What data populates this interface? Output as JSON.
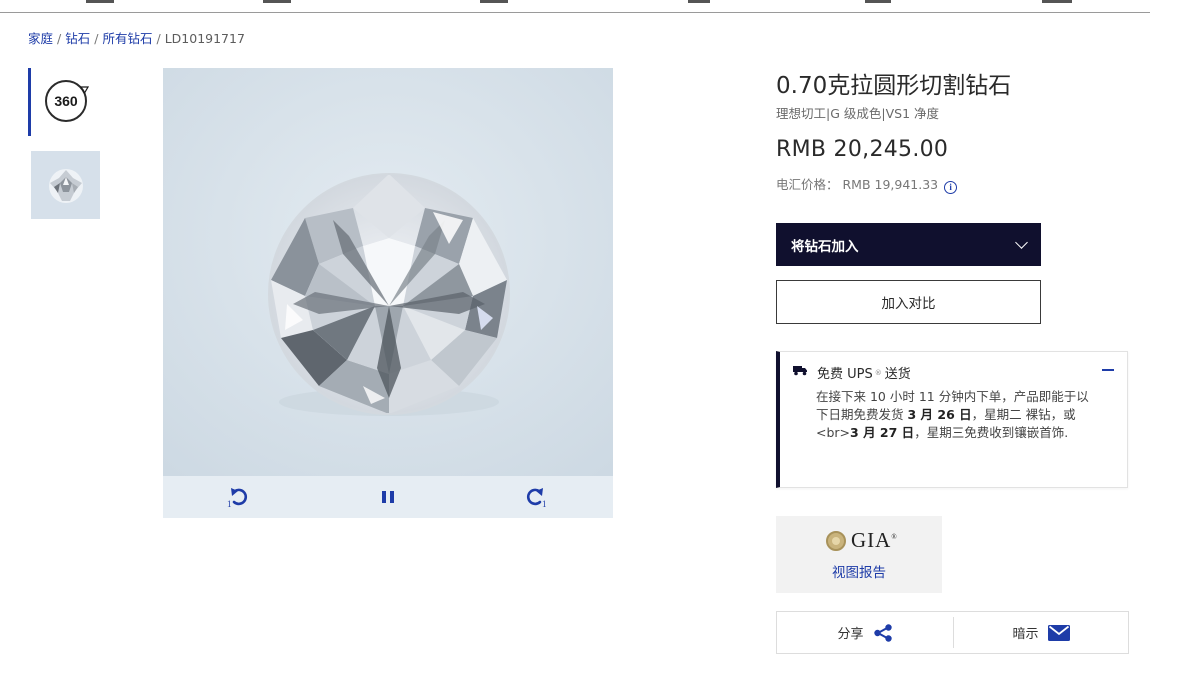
{
  "breadcrumb": {
    "items": [
      "家庭",
      "钻石",
      "所有钻石"
    ],
    "current": "LD10191717",
    "separator": "/"
  },
  "gallery": {
    "thumb_360_label": "360",
    "controls": {
      "rotate_left_label": "1",
      "rotate_right_label": "1"
    }
  },
  "product": {
    "title": "0.70克拉圆形切割钻石",
    "subtitle": "理想切工|G 级成色|VS1 净度",
    "price": "RMB 20,245.00",
    "wire_price": "电汇价格： RMB 19,941.33",
    "info_glyph": "i"
  },
  "actions": {
    "add_label": "将钻石加入",
    "compare_label": "加入对比"
  },
  "shipping": {
    "title": "免费 UPS",
    "title_sup": "®",
    "title_suffix": " 送货",
    "text_1": "在接下来 10 小时 11 分钟内下单，产品即能于以下日期免费发货 ",
    "date_1": "3 月 26 日",
    "text_2": "，星期二 裸钻，或 <br>",
    "date_2": "3 月 27 日",
    "text_3": "，星期三免费收到镶嵌首饰."
  },
  "gia": {
    "logo_text": "GIA",
    "logo_sup": "®",
    "report_label": "视图报告"
  },
  "share": {
    "share_label": "分享",
    "hint_label": "暗示"
  },
  "colors": {
    "accent_blue": "#1e3ca8",
    "navy": "#10102e",
    "viewer_bg": "#d9e4ec"
  },
  "icons": {
    "truck": "truck-icon",
    "share": "share-icon",
    "mail": "mail-icon",
    "info": "info-icon",
    "chevron": "chevron-down-icon",
    "pause": "pause-icon",
    "rotate_left": "rotate-left-icon",
    "rotate_right": "rotate-right-icon"
  }
}
